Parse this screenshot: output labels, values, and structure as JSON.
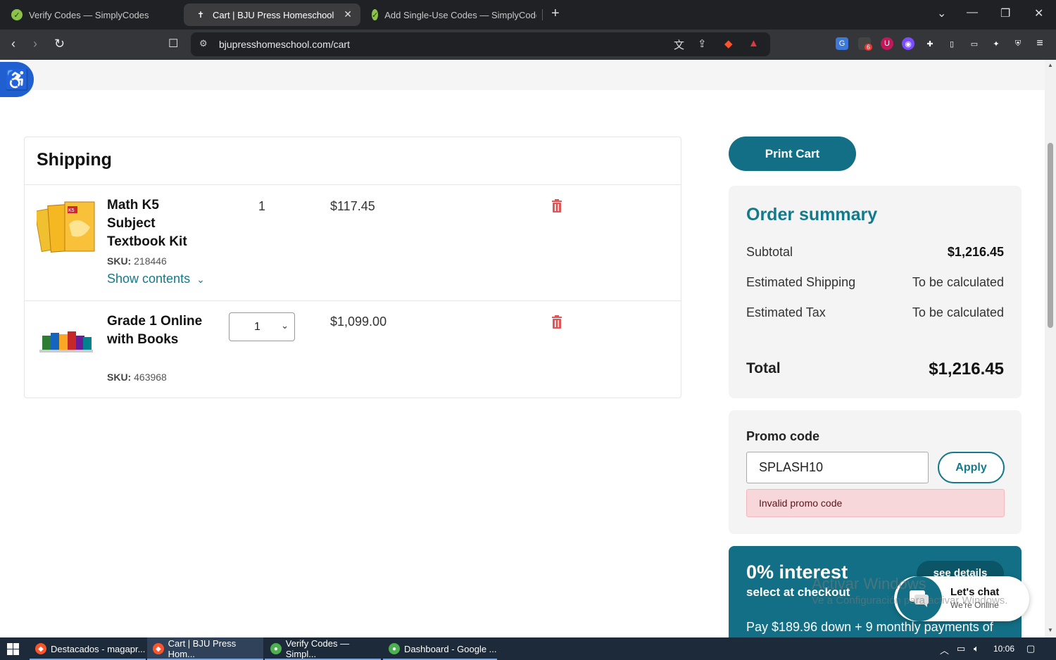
{
  "browser": {
    "tabs": [
      {
        "title": "Verify Codes — SimplyCodes",
        "active": false
      },
      {
        "title": "Cart | BJU Press Homeschool",
        "active": true
      },
      {
        "title": "Add Single-Use Codes — SimplyCode",
        "active": false
      }
    ],
    "url": "bjupresshomeschool.com/cart",
    "extension_badge": "6"
  },
  "cart": {
    "title": "Shipping",
    "items": [
      {
        "name": "Math K5 Subject Textbook Kit",
        "sku_label": "SKU:",
        "sku": "218446",
        "show_contents": "Show contents",
        "quantity": "1",
        "price": "$117.45"
      },
      {
        "name": "Grade 1 Online with Books",
        "sku_label": "SKU:",
        "sku": "463968",
        "quantity": "1",
        "price": "$1,099.00"
      }
    ]
  },
  "actions": {
    "print_cart": "Print Cart"
  },
  "summary": {
    "title": "Order summary",
    "rows": [
      {
        "label": "Subtotal",
        "value": "$1,216.45"
      },
      {
        "label": "Estimated Shipping",
        "value": "To be calculated"
      },
      {
        "label": "Estimated Tax",
        "value": "To be calculated"
      }
    ],
    "total_label": "Total",
    "total_value": "$1,216.45"
  },
  "promo": {
    "label": "Promo code",
    "value": "SPLASH10",
    "apply": "Apply",
    "error": "Invalid promo code"
  },
  "financing": {
    "title": "0% interest",
    "subtitle": "select at checkout",
    "details": "see details",
    "payments": "Pay $189.96 down + 9 monthly payments of"
  },
  "chat": {
    "title": "Let's chat",
    "subtitle": "We're Online"
  },
  "watermark": {
    "line1": "Activar Windows",
    "line2": "Ve a Configuración para activar Windows."
  },
  "taskbar": {
    "items": [
      {
        "label": "Destacados - magapr..."
      },
      {
        "label": "Cart | BJU Press Hom..."
      },
      {
        "label": "Verify Codes — Simpl..."
      },
      {
        "label": "Dashboard - Google ..."
      }
    ],
    "clock": "10:06"
  },
  "colors": {
    "accent": "#136f85",
    "error_bg": "#f8d7da",
    "trash": "#e05555"
  }
}
